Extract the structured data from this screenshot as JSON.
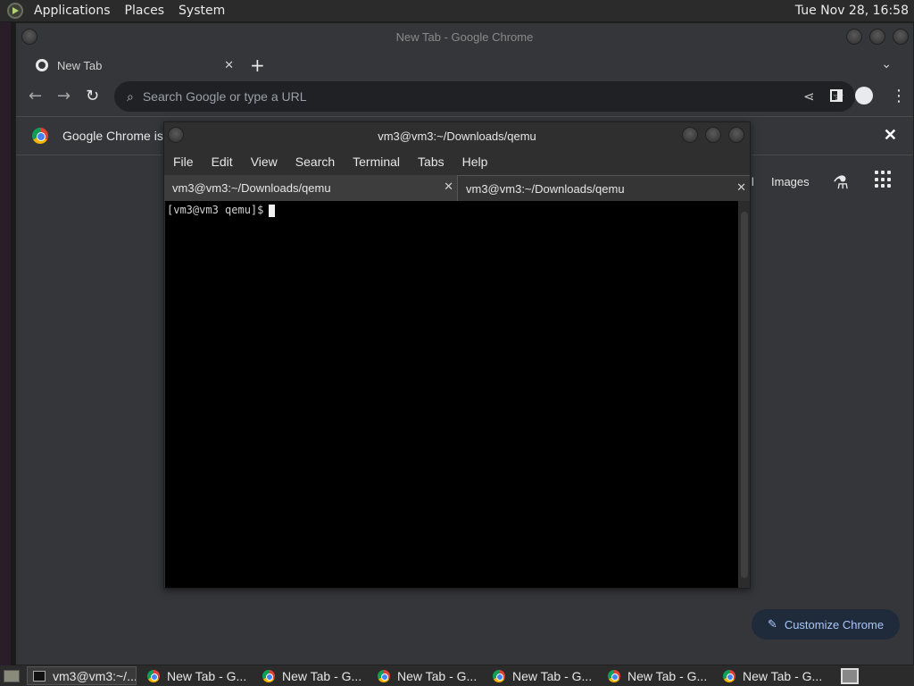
{
  "top_panel": {
    "menus": [
      "Applications",
      "Places",
      "System"
    ],
    "clock": "Tue Nov 28, 16:58"
  },
  "chrome": {
    "window_title": "New Tab - Google Chrome",
    "tab_title": "New Tab",
    "omnibox_placeholder": "Search Google or type a URL",
    "infobar_text": "Google Chrome is",
    "ntp_gmail": "il",
    "ntp_images": "Images",
    "customize_label": "Customize Chrome"
  },
  "terminal": {
    "window_title": "vm3@vm3:~/Downloads/qemu",
    "menus": [
      "File",
      "Edit",
      "View",
      "Search",
      "Terminal",
      "Tabs",
      "Help"
    ],
    "tabs": [
      "vm3@vm3:~/Downloads/qemu",
      "vm3@vm3:~/Downloads/qemu"
    ],
    "prompt": "[vm3@vm3 qemu]$"
  },
  "taskbar": {
    "items": [
      "vm3@vm3:~/...",
      "New Tab - G...",
      "New Tab - G...",
      "New Tab - G...",
      "New Tab - G...",
      "New Tab - G...",
      "New Tab - G..."
    ]
  },
  "colors": {
    "panel_bg": "#2b2b2b",
    "chrome_bg": "#35363a",
    "terminal_bg": "#000000",
    "customize_accent": "#a8c7fa"
  }
}
